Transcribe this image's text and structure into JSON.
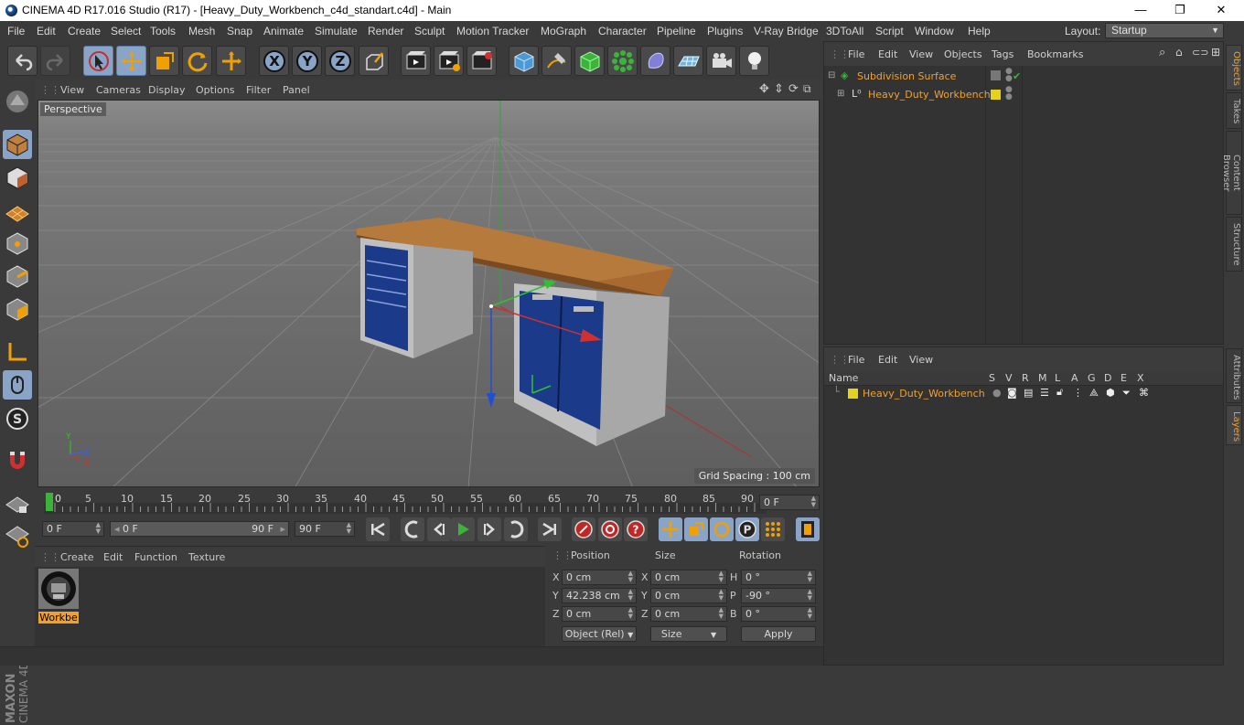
{
  "window": {
    "title": "CINEMA 4D R17.016 Studio (R17) - [Heavy_Duty_Workbench_c4d_standart.c4d] - Main",
    "controls": [
      "—",
      "❐",
      "✕"
    ]
  },
  "menubar": {
    "items": [
      "File",
      "Edit",
      "Create",
      "Select",
      "Tools",
      "Mesh",
      "Snap",
      "Animate",
      "Simulate",
      "Render",
      "Sculpt",
      "Motion Tracker",
      "MoGraph",
      "Character",
      "Pipeline",
      "Plugins",
      "V-Ray Bridge",
      "3DToAll",
      "Script",
      "Window",
      "Help"
    ],
    "layout_label": "Layout:",
    "layout_value": "Startup"
  },
  "toolbar": {
    "icons": [
      "undo-icon",
      "redo-icon",
      "live-selection-icon",
      "move-icon",
      "scale-icon",
      "rotate-icon",
      "recent-tool-icon",
      "x-axis-icon",
      "y-axis-icon",
      "z-axis-icon",
      "coordinate-system-icon",
      "render-view-icon",
      "render-picture-viewer-icon",
      "render-settings-icon",
      "cube-icon",
      "pen-spline-icon",
      "subdivision-icon",
      "array-icon",
      "deformer-icon",
      "floor-icon",
      "camera-icon",
      "light-icon"
    ],
    "axis_labels": [
      "X",
      "Y",
      "Z"
    ]
  },
  "viewport_menu": {
    "items": [
      "View",
      "Cameras",
      "Display",
      "Options",
      "Filter",
      "Panel"
    ],
    "view_label": "Perspective",
    "grid_spacing": "Grid Spacing : 100 cm",
    "axis_gizmo": {
      "y": "Y",
      "z": "Z",
      "x": "X"
    }
  },
  "timeline": {
    "ticks": [
      "0",
      "5",
      "10",
      "15",
      "20",
      "25",
      "30",
      "35",
      "40",
      "45",
      "50",
      "55",
      "60",
      "65",
      "70",
      "75",
      "80",
      "85",
      "90"
    ],
    "current_frame": "0 F"
  },
  "animation": {
    "start": "0 F",
    "slider_left": "0 F",
    "slider_right": "90 F",
    "end": "90 F"
  },
  "material_manager": {
    "menu": [
      "Create",
      "Edit",
      "Function",
      "Texture"
    ],
    "material_name": "Workbe"
  },
  "coordinates": {
    "headers": [
      "Position",
      "Size",
      "Rotation"
    ],
    "rows": [
      {
        "axis": "X",
        "pos": "0 cm",
        "size_axis": "X",
        "size": "0 cm",
        "rot_axis": "H",
        "rot": "0 °"
      },
      {
        "axis": "Y",
        "pos": "42.238 cm",
        "size_axis": "Y",
        "size": "0 cm",
        "rot_axis": "P",
        "rot": "-90 °"
      },
      {
        "axis": "Z",
        "pos": "0 cm",
        "size_axis": "Z",
        "size": "0 cm",
        "rot_axis": "B",
        "rot": "0 °"
      }
    ],
    "mode": "Object (Rel)",
    "size_mode": "Size",
    "apply": "Apply"
  },
  "object_manager": {
    "menu": [
      "File",
      "Edit",
      "View",
      "Objects",
      "Tags",
      "Bookmarks"
    ],
    "objects": [
      {
        "name": "Subdivision Surface"
      },
      {
        "name": "Heavy_Duty_Workbench"
      }
    ]
  },
  "layer_manager": {
    "menu": [
      "File",
      "Edit",
      "View"
    ],
    "columns": [
      "Name",
      "S",
      "V",
      "R",
      "M",
      "L",
      "A",
      "G",
      "D",
      "E",
      "X"
    ],
    "layers": [
      {
        "name": "Heavy_Duty_Workbench"
      }
    ]
  },
  "side_tabs": {
    "top": [
      "Objects",
      "Takes",
      "Content Browser",
      "Structure"
    ],
    "bottom": [
      "Attributes",
      "Layers"
    ]
  },
  "brand": {
    "maxon": "MAXON",
    "product": "CINEMA 4D"
  },
  "colors": {
    "accent": "#f0a030",
    "selected_tool": "#8aa4c8",
    "layer_color": "#e6d21a"
  }
}
